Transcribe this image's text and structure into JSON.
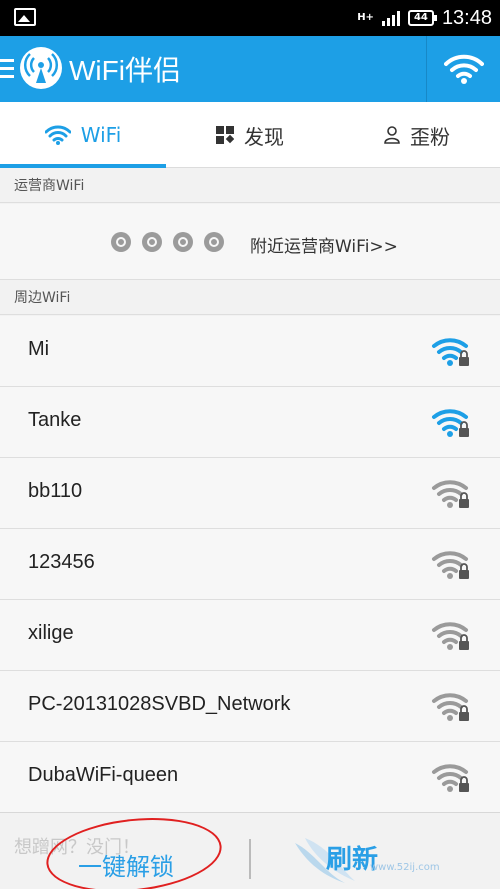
{
  "status_bar": {
    "network": "H+",
    "battery": "44",
    "time": "13:48"
  },
  "app_bar": {
    "title": "WiFi伴侣"
  },
  "tabs": [
    {
      "label": "WiFi",
      "icon": "wifi-icon",
      "active": true
    },
    {
      "label": "发现",
      "icon": "grid-icon",
      "active": false
    },
    {
      "label": "歪粉",
      "icon": "person-icon",
      "active": false
    }
  ],
  "carrier_section": {
    "header": "运营商WiFi",
    "link": "附近运营商WiFi>>",
    "icons": [
      "china-mobile-icon",
      "china-telecom-icon",
      "china-unicom-icon",
      "cmcc-icon"
    ]
  },
  "nearby_section": {
    "header": "周边WiFi",
    "networks": [
      {
        "ssid": "Mi",
        "signal": "strong",
        "locked": true
      },
      {
        "ssid": "Tanke",
        "signal": "strong",
        "locked": true
      },
      {
        "ssid": "bb110",
        "signal": "weak",
        "locked": true
      },
      {
        "ssid": "123456",
        "signal": "weak",
        "locked": true
      },
      {
        "ssid": "xilige",
        "signal": "weak",
        "locked": true
      },
      {
        "ssid": "PC-20131028SVBD_Network",
        "signal": "weak",
        "locked": true
      },
      {
        "ssid": "DubaWiFi-queen",
        "signal": "weak",
        "locked": true
      }
    ]
  },
  "bottom_bar": {
    "ghost_text": "想蹭网？没门！",
    "unlock_label": "一键解锁",
    "refresh_label": "刷新",
    "watermark": "我爱技术网",
    "watermark_url": "www.52ij.com"
  },
  "colors": {
    "accent": "#1d9fe6",
    "strong_signal": "#1d9fe6",
    "weak_signal": "#9a9a9a",
    "annotation": "#e02020"
  }
}
